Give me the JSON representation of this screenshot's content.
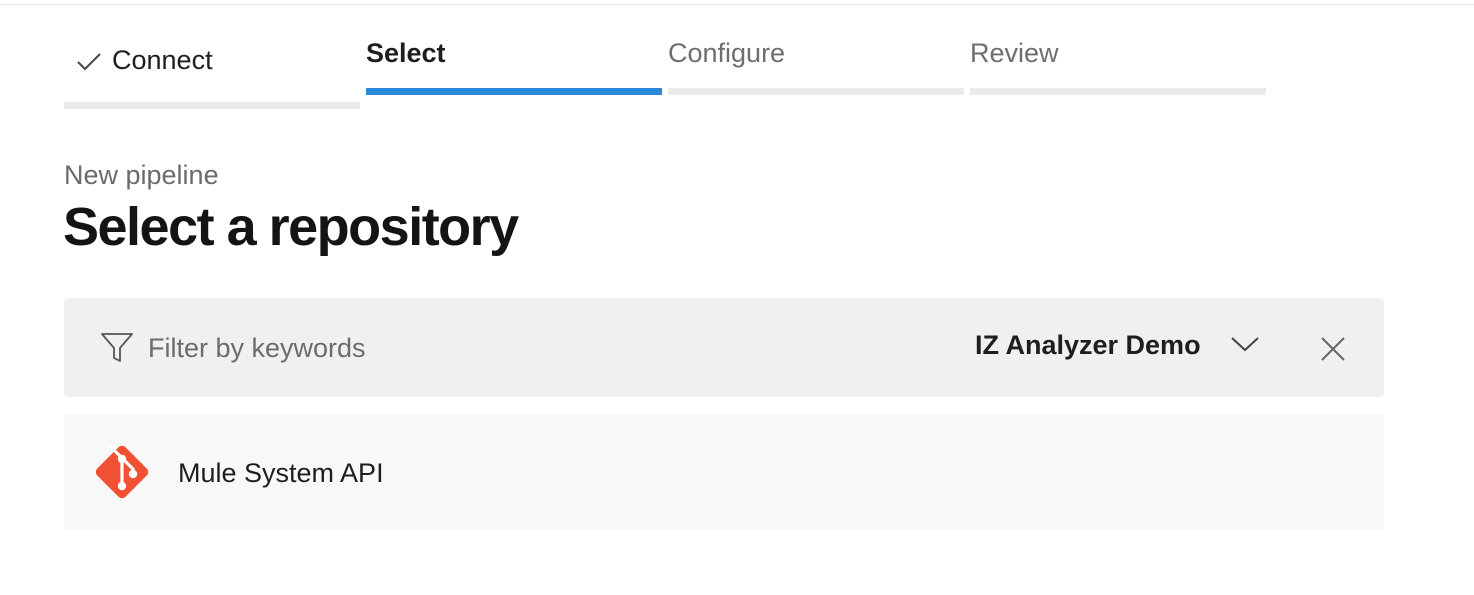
{
  "stepper": {
    "steps": [
      {
        "label": "Connect",
        "state": "completed"
      },
      {
        "label": "Select",
        "state": "active"
      },
      {
        "label": "Configure",
        "state": "pending"
      },
      {
        "label": "Review",
        "state": "pending"
      }
    ]
  },
  "header": {
    "subtitle": "New pipeline",
    "title": "Select a repository"
  },
  "filter": {
    "placeholder": "Filter by keywords",
    "value": "",
    "organization": "IZ Analyzer Demo"
  },
  "repositories": [
    {
      "name": "Mule System API",
      "icon": "git-icon"
    }
  ],
  "colors": {
    "accent": "#2b88d8",
    "git": "#f05133"
  }
}
